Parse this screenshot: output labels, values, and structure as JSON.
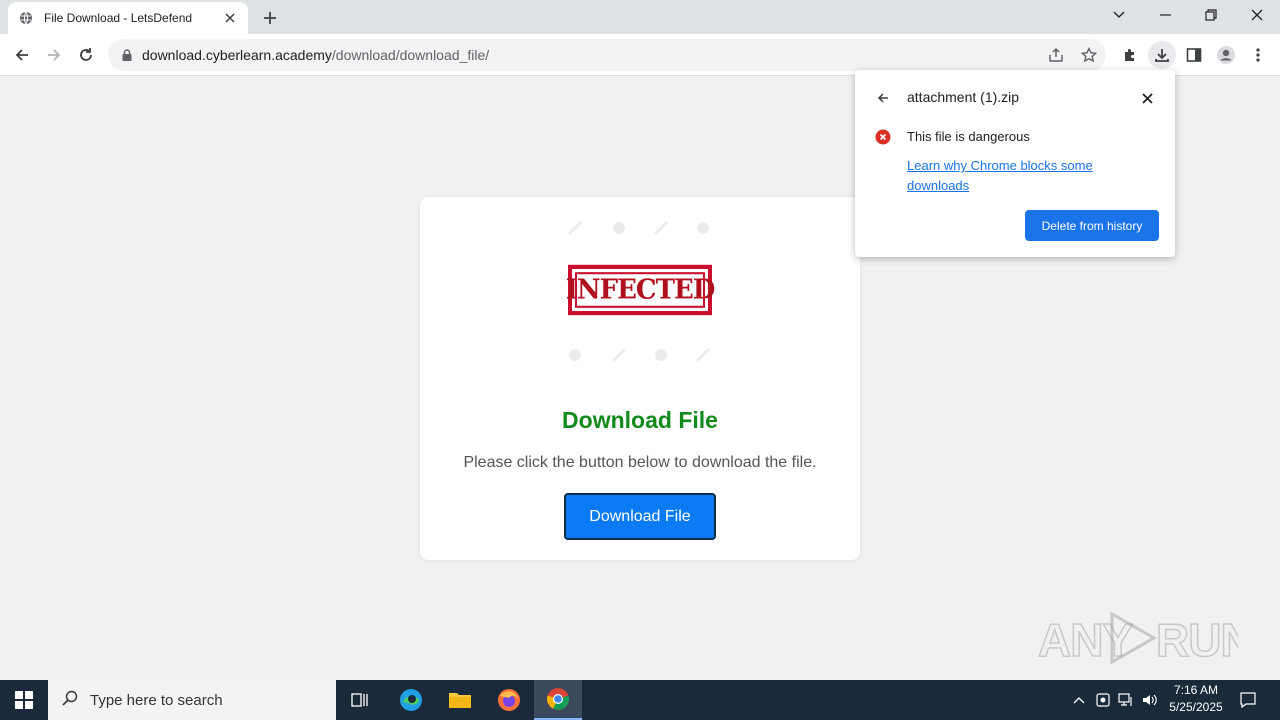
{
  "browser": {
    "tab_title": "File Download - LetsDefend",
    "url_host": "download.cyberlearn.academy",
    "url_path": "/download/download_file/"
  },
  "page": {
    "stamp_text": "INFECTED",
    "title": "Download File",
    "message": "Please click the button below to download the file.",
    "button_label": "Download File",
    "title_color": "#138a1c",
    "button_color": "#0a7bf5"
  },
  "download_bubble": {
    "filename": "attachment (1).zip",
    "warning": "This file is dangerous",
    "learn_link": "Learn why Chrome blocks some downloads",
    "delete_button": "Delete from history"
  },
  "watermark": "ANY RUN",
  "taskbar": {
    "search_placeholder": "Type here to search",
    "time": "7:16 AM",
    "date": "5/25/2025"
  },
  "icons": [
    "globe-icon",
    "close-icon",
    "plus-icon",
    "chevron-down-icon",
    "minimize-icon",
    "restore-icon",
    "back-arrow-icon",
    "forward-arrow-icon",
    "reload-icon",
    "lock-icon",
    "share-icon",
    "star-icon",
    "puzzle-icon",
    "download-icon",
    "sidepanel-icon",
    "profile-icon",
    "kebab-menu-icon",
    "error-icon",
    "windows-logo-icon",
    "search-icon",
    "task-view-icon",
    "edge-icon",
    "folder-icon",
    "firefox-icon",
    "chrome-icon",
    "chevron-up-icon",
    "meet-icon",
    "network-icon",
    "volume-icon",
    "notification-icon"
  ]
}
